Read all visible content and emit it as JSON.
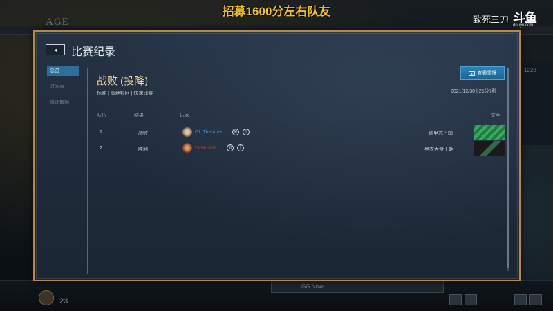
{
  "stream": {
    "title": "招募1600分左右队友",
    "brand": "致死三刀",
    "logo": "斗鱼",
    "logo_sub": "douyu.com"
  },
  "background": {
    "age_label": "AGE",
    "right_panel_num": "1223",
    "bottom_center_text": "GG Nova",
    "left_num": "23"
  },
  "modal": {
    "back_icon": "chevron-left-icon",
    "title": "比赛纪录",
    "sidenav": [
      {
        "label": "总览",
        "active": true
      },
      {
        "label": "时间表",
        "active": false
      },
      {
        "label": "统计数据",
        "active": false
      }
    ],
    "result_title": "战败 (投降)",
    "result_subtitle": "标准 | 高地野区 | 快速比赛",
    "replay_button": "查看重播",
    "match_date": "2021/12/30 | 25分7秒",
    "table": {
      "headers": {
        "team": "队伍",
        "result": "结果",
        "player": "玩家",
        "civ": "文明"
      },
      "rows": [
        {
          "team": "1",
          "result": "战败",
          "player": "GL.TheViper",
          "player_color": "#3f8ed8",
          "civ": "德里苏丹国",
          "flag_colors": [
            "#1f7a3d",
            "#3ba863"
          ]
        },
        {
          "team": "2",
          "result": "胜利",
          "player": "DeMusliM",
          "player_color": "#d23a2e",
          "civ": "黑衣大食王朝",
          "flag_colors": [
            "#1a1a1a",
            "#2f6b4a"
          ]
        }
      ]
    }
  },
  "colors": {
    "modal_border": "#b88a3e",
    "accent_blue": "#2a83b9",
    "result_title": "#f1d9a3"
  }
}
